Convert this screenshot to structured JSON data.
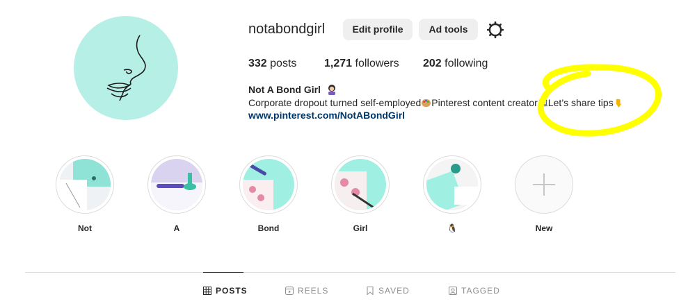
{
  "profile": {
    "username": "notabondgirl",
    "edit_profile_label": "Edit profile",
    "ad_tools_label": "Ad tools",
    "stats": {
      "posts_count": "332",
      "posts_label": "posts",
      "followers_count": "1,271",
      "followers_label": "followers",
      "following_count": "202",
      "following_label": "following"
    },
    "full_name": "Not A Bond Girl",
    "bio": {
      "part1": "Corporate dropout turned self-employed",
      "part2": "Pinterest content creator",
      "part3": "Let’s share tips"
    },
    "website": "www.pinterest.com/NotABondGirl"
  },
  "highlights": [
    {
      "label": "Not"
    },
    {
      "label": "A"
    },
    {
      "label": "Bond"
    },
    {
      "label": "Girl"
    },
    {
      "label": "🐧"
    },
    {
      "label": "New"
    }
  ],
  "tabs": [
    {
      "label": "POSTS",
      "icon": "grid-icon",
      "active": true
    },
    {
      "label": "REELS",
      "icon": "reels-icon",
      "active": false
    },
    {
      "label": "SAVED",
      "icon": "bookmark-icon",
      "active": false
    },
    {
      "label": "TAGGED",
      "icon": "tagged-icon",
      "active": false
    }
  ],
  "colors": {
    "avatar_bg": "#b6efe5",
    "link": "#00376b",
    "annotation": "#ffff00"
  }
}
